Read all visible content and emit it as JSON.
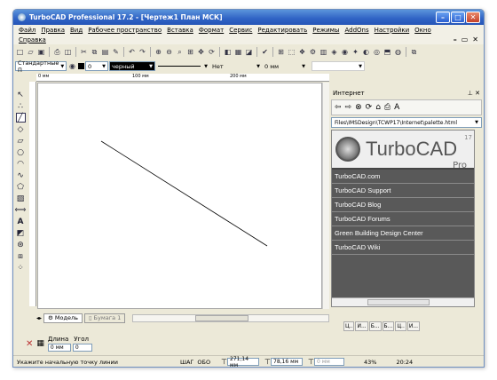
{
  "window": {
    "title": "TurboCAD Professional 17.2 - [Чертеж1 План МСК]"
  },
  "menu": {
    "items": [
      "Файл",
      "Правка",
      "Вид",
      "Рабочее пространство",
      "Вставка",
      "Формат",
      "Сервис",
      "Редактировать",
      "Режимы",
      "AddOns",
      "Настройки",
      "Окно"
    ],
    "help": "Справка"
  },
  "property_bar": {
    "style": "Стандартные П",
    "pen_width": "0",
    "color": "черный",
    "line_style": "Нет",
    "width_value": "0 мм"
  },
  "ruler": {
    "ticks": [
      "0 мм",
      "100 мм",
      "200 мм"
    ]
  },
  "tabs": {
    "model": "Модель",
    "paper": "Бумага 1"
  },
  "design_director": {
    "title": "Интернет",
    "url": "Files\\IMSDesign\\TCWP17\\Internet\\palette.html",
    "logo": {
      "text": "TurboCAD",
      "suffix": "Pro",
      "version": "17"
    },
    "links": [
      "TurboCAD.com",
      "TurboCAD Support",
      "TurboCAD Blog",
      "TurboCAD Forums",
      "Green Building Design Center",
      "TurboCAD Wiki"
    ],
    "bottom_tabs": [
      "Ц..",
      "И...",
      "Б...",
      "Б...",
      "Ц..",
      "И..."
    ]
  },
  "coords": {
    "length_label": "Длина",
    "angle_label": "Угол",
    "length_value": "0 мм",
    "angle_value": "0"
  },
  "status": {
    "prompt": "Укажите начальную точку линии",
    "snap": "ШАГ",
    "ortho": "ОБО",
    "x": "271,14 мм",
    "y": "78,16 мм",
    "z": "0 мм",
    "zoom": "43%",
    "time": "20:24"
  }
}
